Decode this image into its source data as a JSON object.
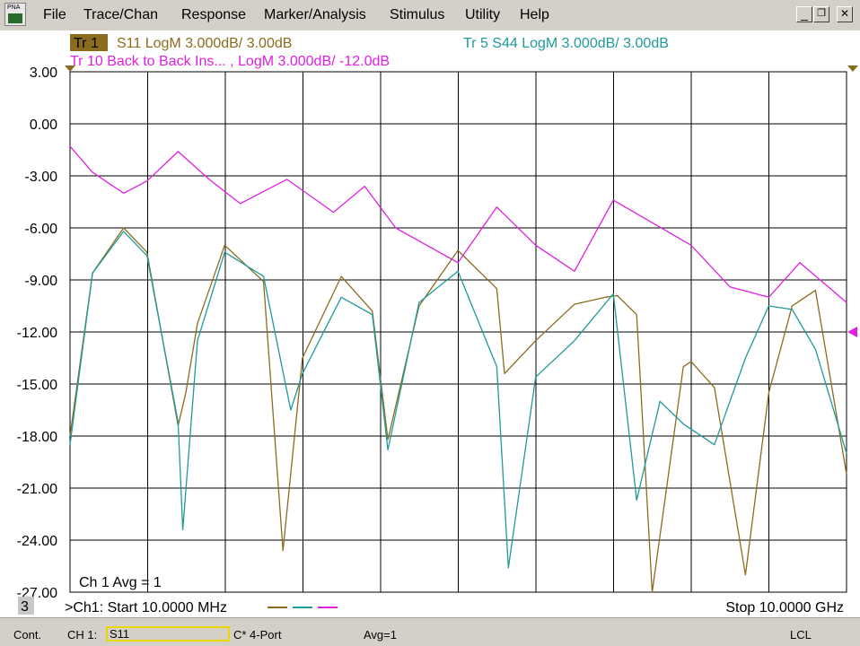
{
  "menu": {
    "app_icon_label": "PNA",
    "items": [
      "File",
      "Trace/Chan",
      "Response",
      "Marker/Analysis",
      "Stimulus",
      "Utility",
      "Help"
    ],
    "minimize": "_",
    "restore": "❐",
    "close": "✕"
  },
  "traces": {
    "tr1_tag": "Tr 1",
    "tr1_desc": "S11 LogM 3.000dB/  3.00dB",
    "tr5_desc": "Tr  5   S44 LogM 3.000dB/  3.00dB",
    "tr10_desc": "Tr 10  Back to Back Ins... ,  LogM 3.000dB/  -12.0dB"
  },
  "colors": {
    "s11": "#8b6c1e",
    "s44": "#1f9a9a",
    "tr10": "#e020e0",
    "grid": "#000000"
  },
  "chart_data": {
    "type": "line",
    "ylim": [
      -27,
      3
    ],
    "xlim": [
      10,
      10000
    ],
    "x_unit": "MHz",
    "ytick_labels": [
      "3.00",
      "0.00",
      "-3.00",
      "-6.00",
      "-9.00",
      "-12.00",
      "-15.00",
      "-18.00",
      "-21.00",
      "-24.00",
      "-27.00"
    ],
    "ref_marker_value": -12,
    "series": [
      {
        "trace": "S11",
        "color": "#8b6c1e",
        "x": [
          10,
          300,
          700,
          1000,
          1400,
          1500,
          1650,
          2000,
          2500,
          2750,
          3000,
          3500,
          3900,
          4100,
          4500,
          5000,
          5500,
          5600,
          6000,
          6500,
          6900,
          7050,
          7300,
          7500,
          7900,
          8000,
          8300,
          8700,
          9000,
          9300,
          9600,
          10000
        ],
        "y": [
          -18,
          -8.6,
          -6.0,
          -7.4,
          -17.4,
          -15.5,
          -11.5,
          -7.0,
          -9.1,
          -24.6,
          -13.5,
          -8.8,
          -10.8,
          -18.2,
          -10.5,
          -7.3,
          -9.5,
          -14.4,
          -12.5,
          -10.4,
          -10.0,
          -9.9,
          -11.0,
          -27.0,
          -14.0,
          -13.7,
          -15.2,
          -26.0,
          -15.5,
          -10.5,
          -9.6,
          -20.2
        ]
      },
      {
        "trace": "S44",
        "color": "#1f9a9a",
        "x": [
          10,
          300,
          700,
          1000,
          1400,
          1460,
          1650,
          2000,
          2500,
          2850,
          3000,
          3500,
          3900,
          4100,
          4500,
          5000,
          5500,
          5650,
          6000,
          6500,
          7000,
          7300,
          7600,
          7900,
          8300,
          8700,
          9000,
          9300,
          9600,
          10000
        ],
        "y": [
          -18.5,
          -8.6,
          -6.2,
          -7.6,
          -17.2,
          -23.4,
          -12.5,
          -7.4,
          -8.8,
          -16.5,
          -14.4,
          -10.0,
          -11.0,
          -18.8,
          -10.3,
          -8.5,
          -14.0,
          -25.6,
          -14.6,
          -12.5,
          -9.8,
          -21.7,
          -16.0,
          -17.3,
          -18.5,
          -13.5,
          -10.5,
          -10.7,
          -13.0,
          -19.0
        ]
      },
      {
        "trace": "Tr 10",
        "color": "#e020e0",
        "x": [
          10,
          300,
          700,
          1000,
          1400,
          1800,
          2200,
          2800,
          3400,
          3800,
          4200,
          5000,
          5500,
          6000,
          6500,
          7000,
          7500,
          8000,
          8500,
          9000,
          9400,
          10000
        ],
        "y": [
          -1.3,
          -2.8,
          -4.0,
          -3.3,
          -1.6,
          -3.2,
          -4.6,
          -3.2,
          -5.1,
          -3.6,
          -6.0,
          -8.0,
          -4.8,
          -7.0,
          -8.5,
          -4.4,
          -5.7,
          -7.0,
          -9.4,
          -10.0,
          -8.0,
          -10.3
        ]
      }
    ]
  },
  "footer": {
    "avg": "Ch 1 Avg =     1",
    "ch_number": "3",
    "start": ">Ch1:  Start  10.0000 MHz",
    "stop": "Stop  10.0000 GHz"
  },
  "status": {
    "cont": "Cont.",
    "ch": "CH 1:",
    "meas": "S11",
    "port": "C* 4-Port",
    "avg": "Avg=1",
    "lcl": "LCL"
  }
}
